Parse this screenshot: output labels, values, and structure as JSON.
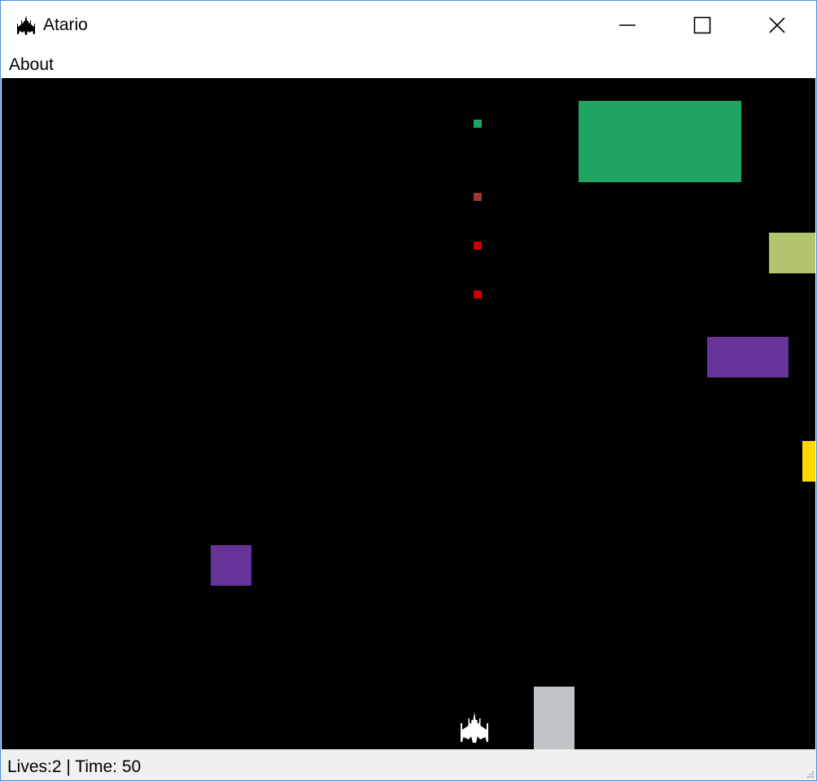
{
  "window": {
    "title": "Atario",
    "app_icon": "spaceship-icon",
    "controls": {
      "minimize_icon": "minimize-icon",
      "maximize_icon": "maximize-icon",
      "close_icon": "close-icon"
    }
  },
  "menu": {
    "items": [
      {
        "label": "About"
      }
    ]
  },
  "game": {
    "background": "#000000",
    "player_icon": "spaceship-icon",
    "player_color": "#ffffff",
    "blocks": [
      {
        "name": "block-green-large",
        "color": "#1fa463"
      },
      {
        "name": "block-lime",
        "color": "#b2c56e"
      },
      {
        "name": "block-purple-right",
        "color": "#663399"
      },
      {
        "name": "block-yellow",
        "color": "#ffd700"
      },
      {
        "name": "block-purple-left",
        "color": "#663399"
      },
      {
        "name": "block-gray",
        "color": "#c0c4c7"
      }
    ],
    "projectiles": [
      {
        "name": "projectile-green",
        "color": "#1fa463"
      },
      {
        "name": "projectile-brown",
        "color": "#a0392c"
      },
      {
        "name": "projectile-red-1",
        "color": "#cc0000"
      },
      {
        "name": "projectile-red-2",
        "color": "#cc0000"
      }
    ]
  },
  "status": {
    "lives_label": "Lives:",
    "lives": 2,
    "separator": " | ",
    "time_label": "Time: ",
    "time": 50,
    "text": "Lives:2 | Time: 50"
  }
}
